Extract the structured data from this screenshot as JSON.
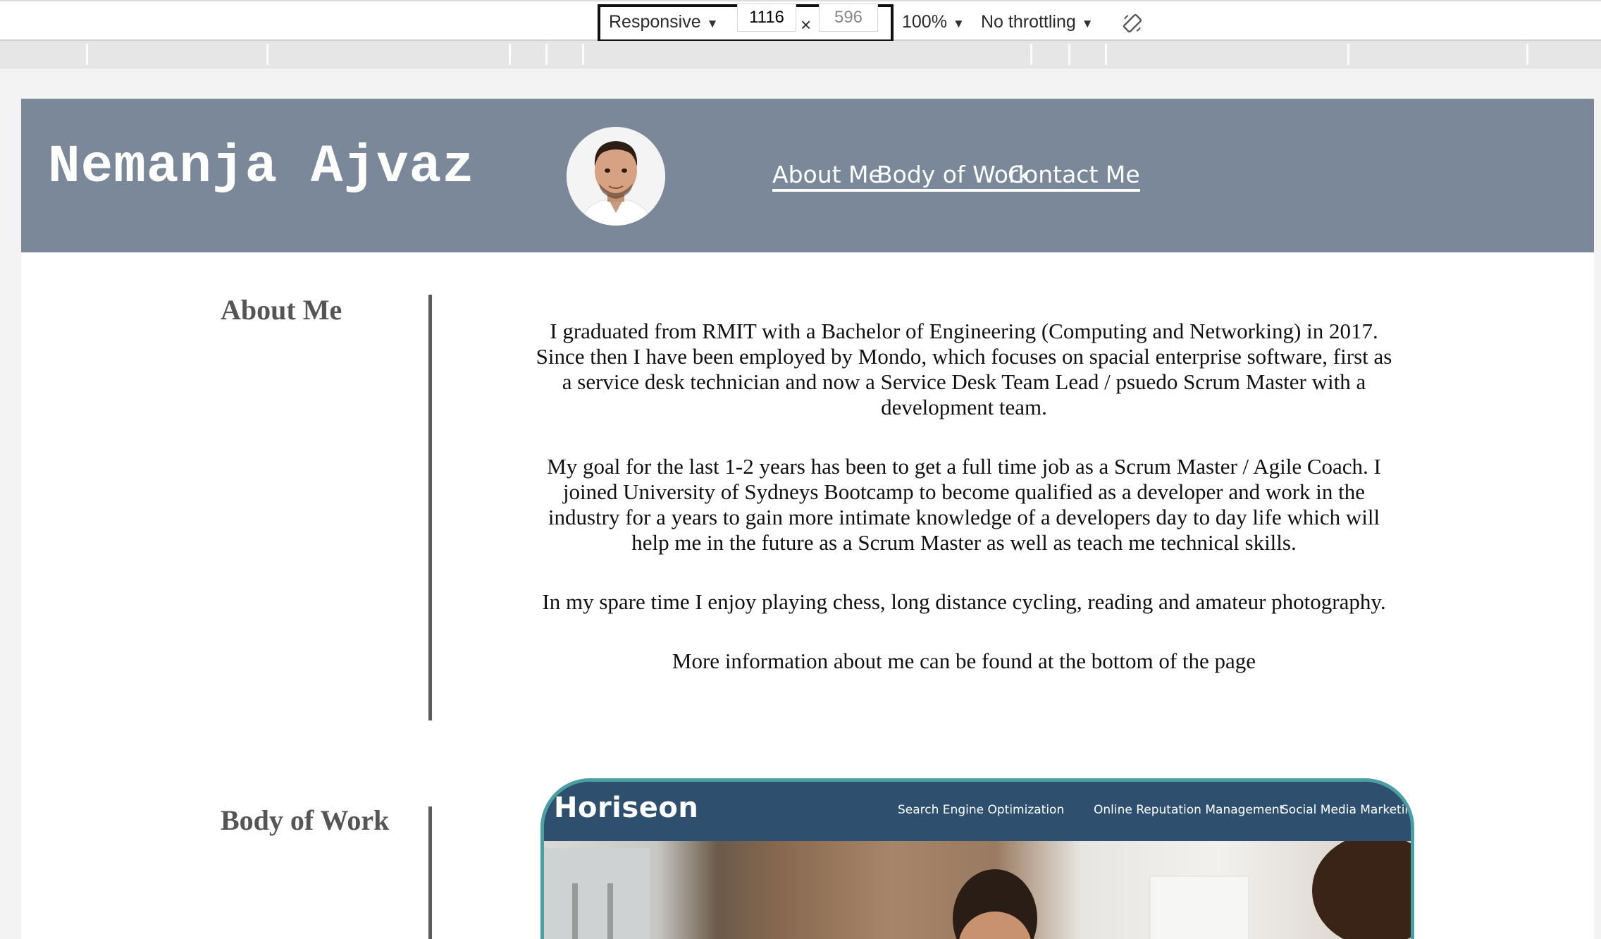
{
  "devtools": {
    "device": "Responsive",
    "width": "1116",
    "times": "×",
    "height": "596",
    "zoom": "100%",
    "throttling": "No throttling"
  },
  "header": {
    "title": "Nemanja Ajvaz",
    "nav": [
      "About Me",
      "Body of Work",
      "Contact Me"
    ]
  },
  "about": {
    "heading": "About Me",
    "paragraphs": [
      "I graduated from RMIT with a Bachelor of Engineering (Computing and Networking) in 2017. Since then I have been employed by Mondo, which focuses on spacial enterprise software, first as a service desk technician and now a Service Desk Team Lead / psuedo Scrum Master with a development team.",
      "My goal for the last 1-2 years has been to get a full time job as a Scrum Master / Agile Coach. I joined University of Sydneys Bootcamp to become qualified as a developer and work in the industry for a years to gain more intimate knowledge of a developers day to day life which will help me in the future as a Scrum Master as well as teach me technical skills.",
      "In my spare time I enjoy playing chess, long distance cycling, reading and amateur photography.",
      "More information about me can be found at the bottom of the page"
    ]
  },
  "work": {
    "heading": "Body of Work",
    "project": {
      "brand": "Horiseon",
      "nav": [
        "Search Engine Optimization",
        "Online Reputation Management",
        "Social Media Marketing"
      ]
    }
  },
  "colors": {
    "header_bg": "#7a8899",
    "project_border": "#4a9fa3",
    "project_header": "#2f4f6f"
  }
}
